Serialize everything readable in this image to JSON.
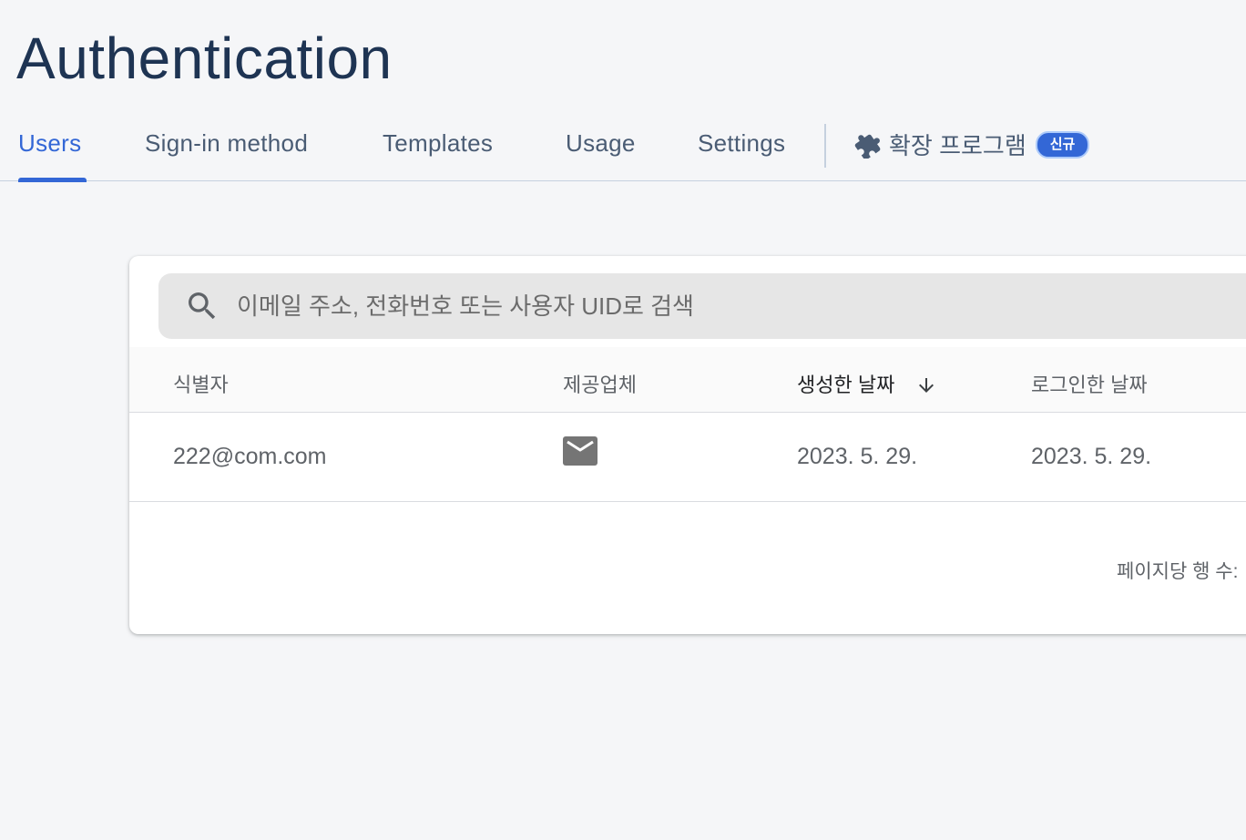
{
  "header": {
    "title": "Authentication"
  },
  "tabs": [
    {
      "label": "Users",
      "active": true
    },
    {
      "label": "Sign-in method",
      "active": false
    },
    {
      "label": "Templates",
      "active": false
    },
    {
      "label": "Usage",
      "active": false
    },
    {
      "label": "Settings",
      "active": false
    }
  ],
  "extensions_tab": {
    "label": "확장 프로그램",
    "badge": "신규",
    "icon": "puzzle-icon"
  },
  "search": {
    "placeholder": "이메일 주소, 전화번호 또는 사용자 UID로 검색",
    "value": "",
    "icon": "search-icon"
  },
  "table": {
    "columns": [
      {
        "label": "식별자"
      },
      {
        "label": "제공업체"
      },
      {
        "label": "생성한 날짜",
        "sorted": "descending"
      },
      {
        "label": "로그인한 날짜"
      }
    ],
    "rows": [
      {
        "identifier": "222@com.com",
        "provider_icon": "email-icon",
        "created": "2023. 5. 29.",
        "signed_in": "2023. 5. 29."
      }
    ]
  },
  "footer": {
    "rows_per_page_label": "페이지당 행 수:"
  },
  "colors": {
    "accent": "#3367d6",
    "title": "#1e3453",
    "tab_text": "#4a5c74",
    "background": "#f5f6f8"
  }
}
